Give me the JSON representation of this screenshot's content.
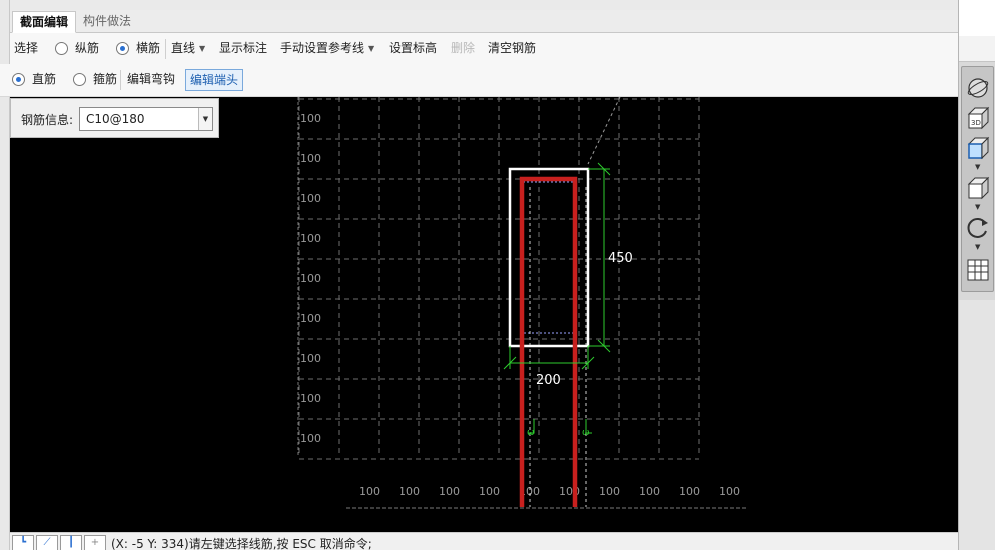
{
  "tabs": [
    {
      "label": "截面编辑",
      "active": true
    },
    {
      "label": "构件做法",
      "active": false
    }
  ],
  "toolbar1": {
    "select": "选择",
    "longitudinal": "纵筋",
    "transverse": "横筋",
    "line": "直线",
    "show_dim": "显示标注",
    "manual_ref": "手动设置参考线",
    "set_elev": "设置标高",
    "delete": "删除",
    "clear": "清空钢筋"
  },
  "toolbar2": {
    "straight": "直筋",
    "stirrup": "箍筋",
    "edit_hook": "编辑弯钩",
    "edit_end": "编辑端头"
  },
  "radio_state": {
    "transverse_selected": true,
    "straight_selected": true
  },
  "rebar_info": {
    "label": "钢筋信息:",
    "value": "C10@180"
  },
  "drawing": {
    "row_labels": [
      "100",
      "100",
      "100",
      "100",
      "100",
      "100",
      "100",
      "100",
      "100"
    ],
    "col_labels": [
      "100",
      "100",
      "100",
      "100",
      "100",
      "100",
      "100",
      "100",
      "100",
      "100"
    ],
    "dim_height": "450",
    "dim_width": "200",
    "hook_mark": "ω"
  },
  "status": {
    "icons": [
      "┗",
      "⟋",
      "┃",
      "+"
    ],
    "text": "(X: -5 Y: 334)请左键选择线筋,按 ESC 取消命令;"
  },
  "colors": {
    "canvas_bg": "#000000",
    "grid": "#6e6e6e",
    "rebar": "#c8201e",
    "dim": "#2ecc2e",
    "section": "#ffffff",
    "accent": "#2a6fd0"
  },
  "right_tools": [
    "sphere-icon",
    "3d-box-icon",
    "front-view-icon",
    "iso-view-icon",
    "rotate-icon",
    "grid-view-icon"
  ]
}
